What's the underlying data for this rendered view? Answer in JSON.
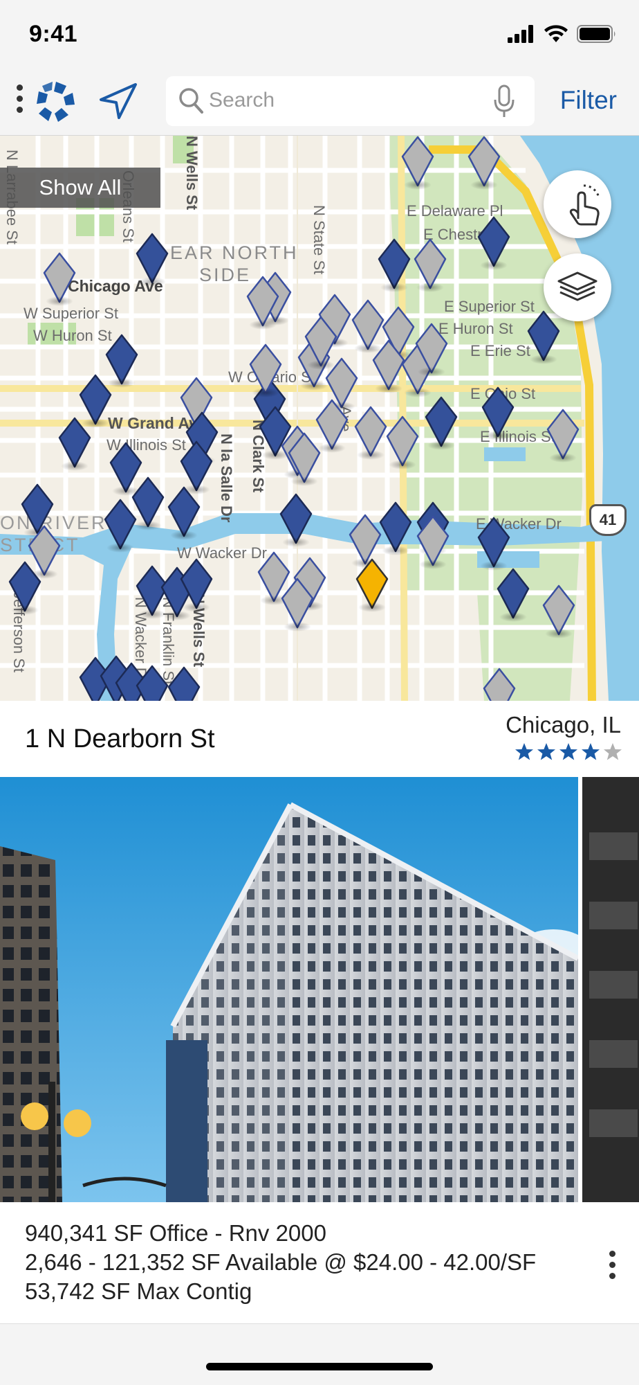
{
  "status": {
    "time": "9:41"
  },
  "toolbar": {
    "search_placeholder": "Search",
    "filter_label": "Filter"
  },
  "colors": {
    "accent": "#1a5aa6",
    "pin_blue": "#34519a",
    "pin_gray": "#b5b5b5",
    "pin_selected": "#f5b301"
  },
  "map": {
    "show_all_label": "Show All",
    "route_badge": "41",
    "labels": {
      "wells_st": "N Wells St",
      "larrabee_st": "N Larrabee St",
      "orleans_st": "Orleans St",
      "state_st": "N State St",
      "near_north_1": "EAR NORTH",
      "near_north_2": "SIDE",
      "chicago_ave": "Chicago Ave",
      "superior_w": "W Superior St",
      "huron_w": "W Huron St",
      "delaware": "E Delaware Pl",
      "chestnut": "E Chestnut",
      "superior_e": "E Superior St",
      "huron_e": "E Huron St",
      "erie_e": "E Erie St",
      "ontario": "W Ontario St",
      "ohio_e": "E Ohio St",
      "grand": "W Grand Ave",
      "illinois_w": "W Illinois St",
      "illinois_e": "E Illinois St",
      "lasalle": "N la Salle Dr",
      "clark": "N Clark St",
      "wacker_w": "W Wacker Dr",
      "wacker_e": "E Wacker Dr",
      "river_1": "ON RIVER",
      "river_2": "STRICT",
      "wacker_n": "N Wacker Dr",
      "franklin": "N Franklin St",
      "wells_s": "N Wells St",
      "jefferson": "N Jefferson St",
      "wabash": "Ave"
    }
  },
  "property": {
    "address": "1 N Dearborn St",
    "city": "Chicago, IL",
    "rating": 4,
    "rating_max": 5,
    "line1": "940,341 SF Office - Rnv 2000",
    "line2": "2,646 - 121,352 SF Available @ $24.00 - 42.00/SF",
    "line3": "53,742 SF Max Contig"
  }
}
